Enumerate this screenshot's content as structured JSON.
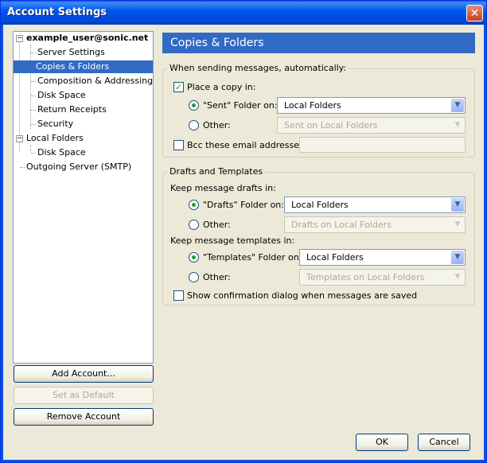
{
  "window": {
    "title": "Account Settings",
    "close_glyph": "✕"
  },
  "tree": {
    "account": "example_user@sonic.net",
    "account_children": [
      "Server Settings",
      "Copies & Folders",
      "Composition & Addressing",
      "Disk Space",
      "Return Receipts",
      "Security"
    ],
    "local": "Local Folders",
    "local_children": [
      "Disk Space"
    ],
    "smtp": "Outgoing Server (SMTP)",
    "selected": "Copies & Folders"
  },
  "left_buttons": {
    "add": "Add Account...",
    "default": "Set as Default",
    "remove": "Remove Account"
  },
  "panel": {
    "header": "Copies & Folders",
    "sending": {
      "legend": "When sending messages, automatically:",
      "place_copy": "Place a copy in:",
      "sent_folder": "\"Sent\" Folder on:",
      "sent_value": "Local Folders",
      "other": "Other:",
      "other_value": "Sent on Local Folders",
      "bcc": "Bcc these email addresses:",
      "bcc_value": ""
    },
    "drafts": {
      "legend": "Drafts and Templates",
      "keep_drafts": "Keep message drafts in:",
      "drafts_folder": "\"Drafts\" Folder on:",
      "drafts_value": "Local Folders",
      "other": "Other:",
      "drafts_other_value": "Drafts on Local Folders",
      "keep_templates": "Keep message templates in:",
      "templates_folder": "\"Templates\" Folder on:",
      "templates_value": "Local Folders",
      "templates_other_value": "Templates on Local Folders",
      "show_confirm": "Show confirmation dialog when messages are saved"
    }
  },
  "footer": {
    "ok": "OK",
    "cancel": "Cancel"
  },
  "icons": {
    "check": "✓",
    "expander": "−",
    "dropdown": "▼"
  }
}
